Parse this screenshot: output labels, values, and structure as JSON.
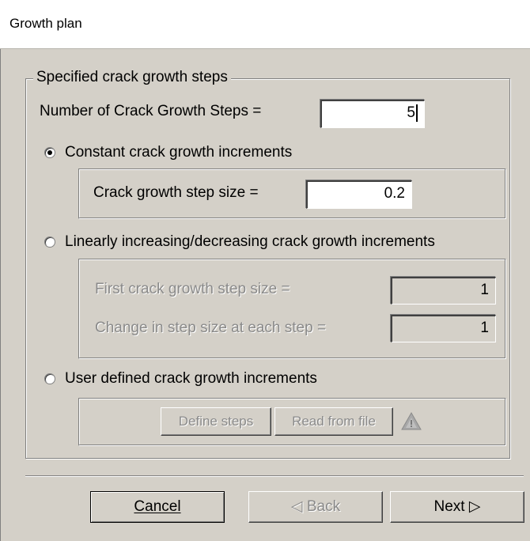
{
  "window": {
    "title": "Growth plan"
  },
  "group": {
    "legend": "Specified crack growth steps",
    "num_steps_label": "Number of Crack Growth Steps =",
    "num_steps_value": "5"
  },
  "options": {
    "constant": {
      "label": "Constant crack growth increments",
      "selected": true,
      "step_size_label": "Crack growth step size =",
      "step_size_value": "0.2"
    },
    "linear": {
      "label": "Linearly increasing/decreasing crack growth increments",
      "selected": false,
      "first_label": "First crack growth step size =",
      "first_value": "1",
      "change_label": "Change in step size at each step =",
      "change_value": "1"
    },
    "user": {
      "label": "User defined crack growth increments",
      "selected": false,
      "define_label": "Define steps",
      "read_label": "Read from file"
    }
  },
  "footer": {
    "cancel_label": "Cancel",
    "back_label": "Back",
    "next_label": "Next"
  },
  "icons": {
    "warning": "warning-triangle-icon",
    "back": "left-triangle-icon",
    "next": "right-triangle-icon"
  }
}
